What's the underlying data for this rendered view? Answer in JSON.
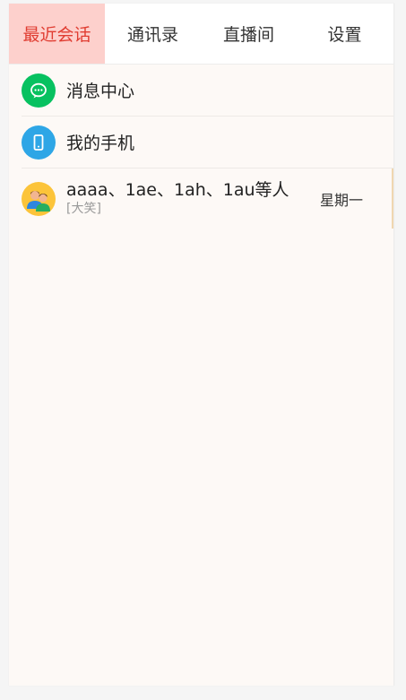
{
  "tabs": [
    {
      "label": "最近会话",
      "active": true
    },
    {
      "label": "通讯录",
      "active": false
    },
    {
      "label": "直播间",
      "active": false
    },
    {
      "label": "设置",
      "active": false
    }
  ],
  "entries": {
    "message_center": {
      "label": "消息中心",
      "icon": "chat-bubble-icon"
    },
    "my_phone": {
      "label": "我的手机",
      "icon": "phone-icon"
    }
  },
  "conversations": [
    {
      "title": "aaaa、1ae、1ah、1au等人",
      "preview": "[大笑]",
      "time": "星期一",
      "icon": "group-avatar-icon"
    }
  ],
  "colors": {
    "active_tab_bg": "#fdd0cc",
    "active_tab_text": "#e03c31",
    "message_icon_bg": "#07c160",
    "phone_icon_bg": "#2ea6e6",
    "group_avatar_bg": "#fcc43a"
  }
}
